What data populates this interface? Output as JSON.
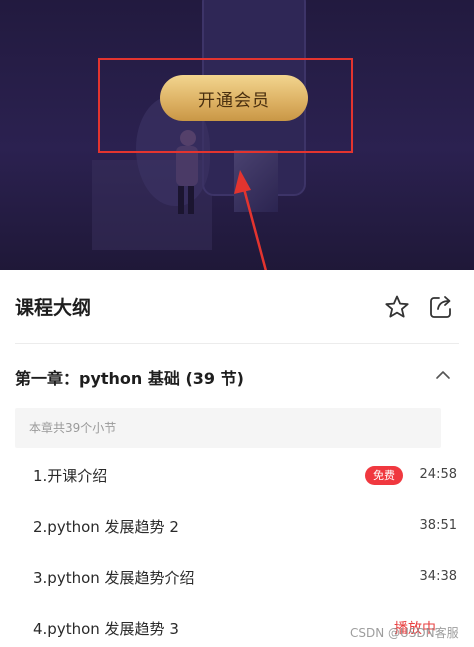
{
  "hero": {
    "vip_button_label": "开通会员"
  },
  "outline": {
    "title": "课程大纲",
    "favorite_icon": "star-icon",
    "share_icon": "share-icon"
  },
  "chapter": {
    "title": "第一章：python 基础 (39 节)",
    "toggle_icon": "chevron-up-icon",
    "info": "本章共39个小节"
  },
  "lessons": [
    {
      "title": "1.开课介绍",
      "badge": "免费",
      "duration": "24:58"
    },
    {
      "title": "2.python 发展趋势 2",
      "duration": "38:51"
    },
    {
      "title": "3.python 发展趋势介绍",
      "duration": "34:38"
    },
    {
      "title": "4.python 发展趋势 3",
      "status": "播放中"
    }
  ],
  "watermark": "CSDN @USDN客服",
  "colors": {
    "hero_bg": "#2b2150",
    "vip_gold": "#dcb062",
    "annotation_red": "#e3342f",
    "free_badge": "#f0383f",
    "playing_red": "#e84040"
  }
}
